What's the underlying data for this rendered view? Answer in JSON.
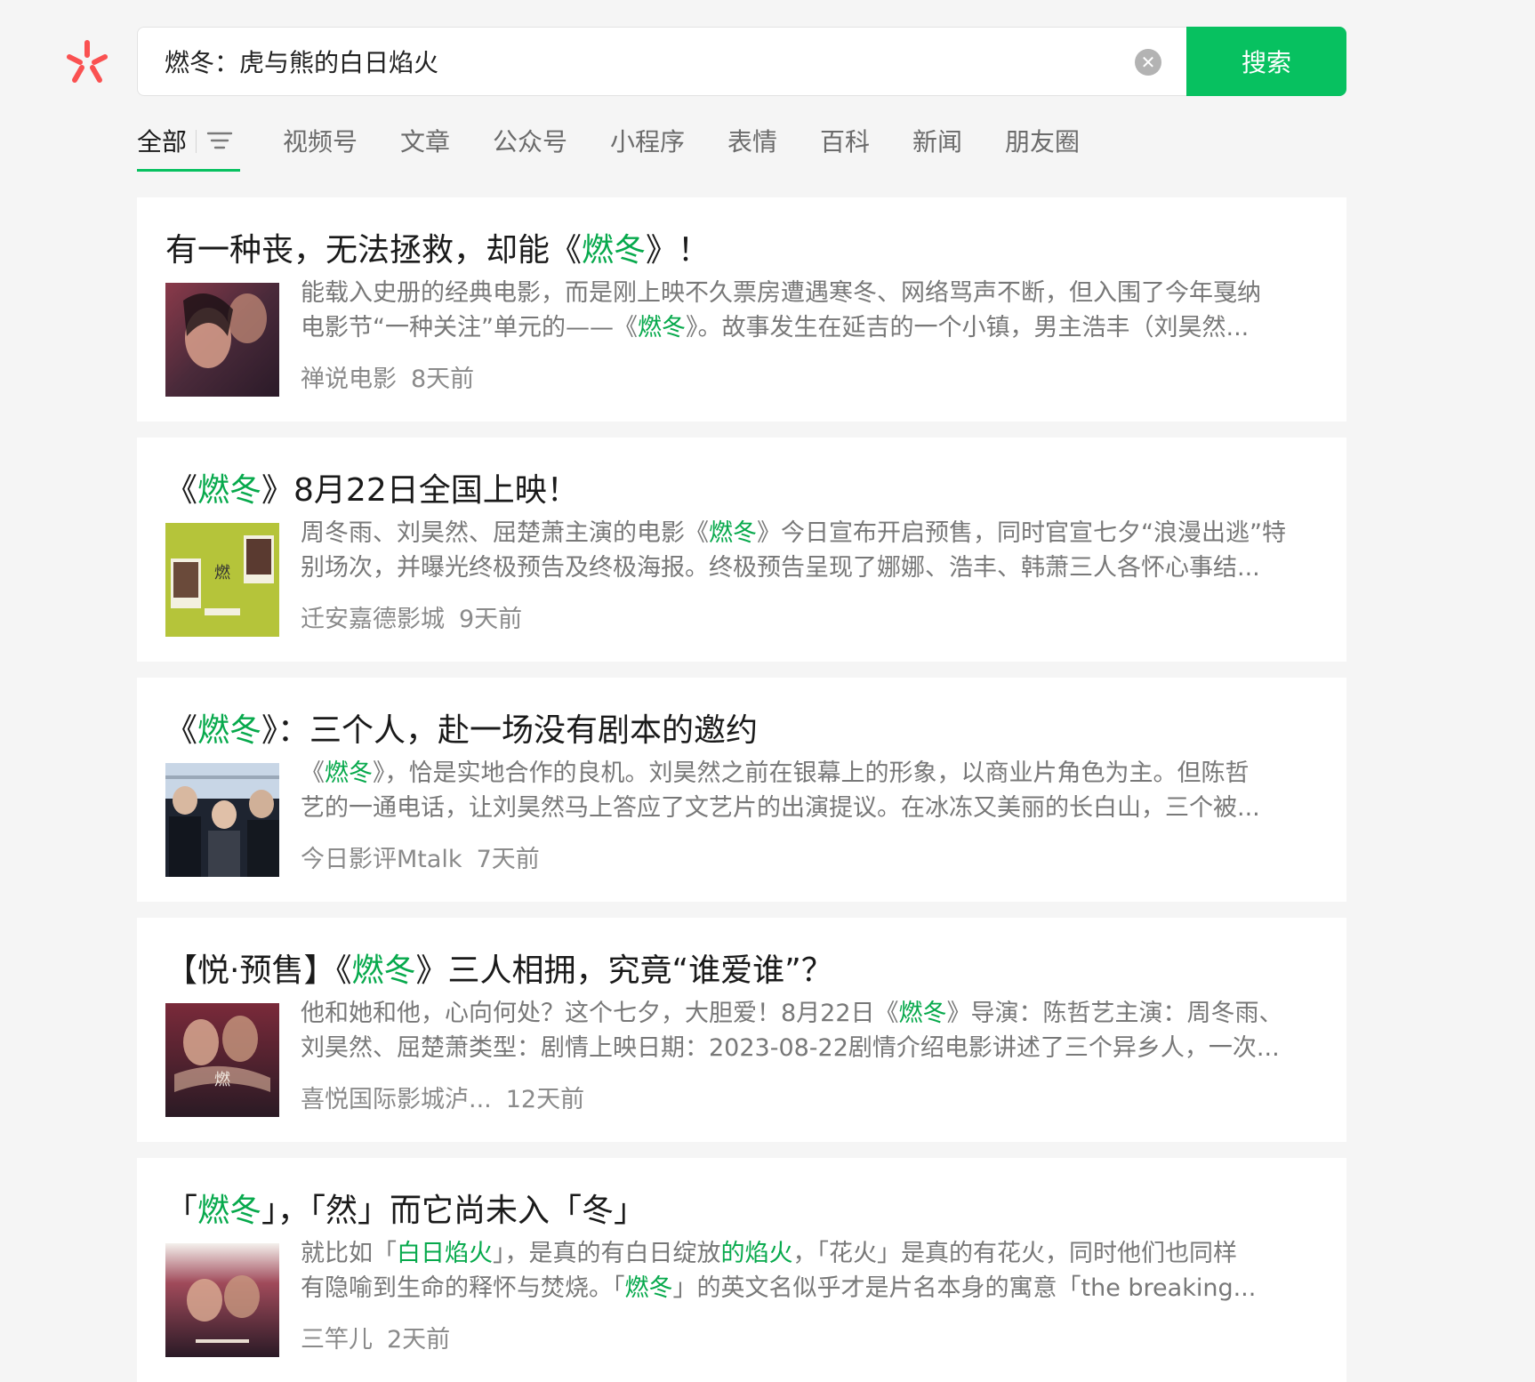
{
  "search": {
    "query": "燃冬：虎与熊的白日焰火",
    "button_label": "搜索",
    "clear_icon": "close-circle-icon"
  },
  "tabs": [
    {
      "label": "全部",
      "active": true
    },
    {
      "label": "视频号"
    },
    {
      "label": "文章"
    },
    {
      "label": "公众号"
    },
    {
      "label": "小程序"
    },
    {
      "label": "表情"
    },
    {
      "label": "百科"
    },
    {
      "label": "新闻"
    },
    {
      "label": "朋友圈"
    }
  ],
  "colors": {
    "accent": "#07c160",
    "highlight": "#07a94c",
    "logo": "#fa5151"
  },
  "results": [
    {
      "title_pre": "有一种丧，无法拯救，却能《",
      "title_hl": "燃冬",
      "title_post": "》！",
      "line1": "能载入史册的经典电影，而是刚上映不久票房遭遇寒冬、网络骂声不断，但入围了今年戛纳",
      "line2_pre": "电影节“一种关注”单元的——《",
      "line2_hl": "燃冬",
      "line2_post": "》。故事发生在延吉的一个小镇，男主浩丰（刘昊然...",
      "source": "禅说电影",
      "time": "8天前"
    },
    {
      "title_pre": "《",
      "title_hl": "燃冬",
      "title_post": "》8月22日全国上映！",
      "line1_pre": "周冬雨、刘昊然、屈楚萧主演的电影《",
      "line1_hl": "燃冬",
      "line1_post": "》今日宣布开启预售，同时官宣七夕“浪漫出逃”特",
      "line2": "别场次，并曝光终极预告及终极海报。终极预告呈现了娜娜、浩丰、韩萧三人各怀心事结...",
      "source": "迁安嘉德影城",
      "time": "9天前"
    },
    {
      "title_pre": "《",
      "title_hl": "燃冬",
      "title_post": "》：三个人，赴一场没有剧本的邀约",
      "line1_pre": "《",
      "line1_hl": "燃冬",
      "line1_post": "》，恰是实地合作的良机。刘昊然之前在银幕上的形象，以商业片角色为主。但陈哲",
      "line2": "艺的一通电话，让刘昊然马上答应了文艺片的出演提议。在冰冻又美丽的长白山，三个被...",
      "source": "今日影评Mtalk",
      "time": "7天前"
    },
    {
      "title_pre": "【悦·预售】《",
      "title_hl": "燃冬",
      "title_post": "》三人相拥，究竟“谁爱谁”？",
      "line1_pre": "他和她和他，心向何处？这个七夕，大胆爱！8月22日《",
      "line1_hl": "燃冬",
      "line1_post": "》导演：陈哲艺主演：周冬雨、",
      "line2": "刘昊然、屈楚萧类型：剧情上映日期：2023-08-22剧情介绍电影讲述了三个异乡人，一次...",
      "source": "喜悦国际影城泸...",
      "time": "12天前"
    },
    {
      "title_pre": "「",
      "title_hl": "燃冬",
      "title_post": "」，「然」而它尚未入「冬」",
      "line1_a": "就比如「",
      "line1_hl1": "白日焰火",
      "line1_b": "」，是真的有白日绽放",
      "line1_hl2": "的焰火",
      "line1_c": "，「花火」是真的有花火，同时他们也同样",
      "line2_pre": "有隐喻到生命的释怀与焚烧。「",
      "line2_hl": "燃冬",
      "line2_post": "」的英文名似乎才是片名本身的寓意「the breaking...",
      "source": "三竿儿",
      "time": "2天前"
    }
  ]
}
